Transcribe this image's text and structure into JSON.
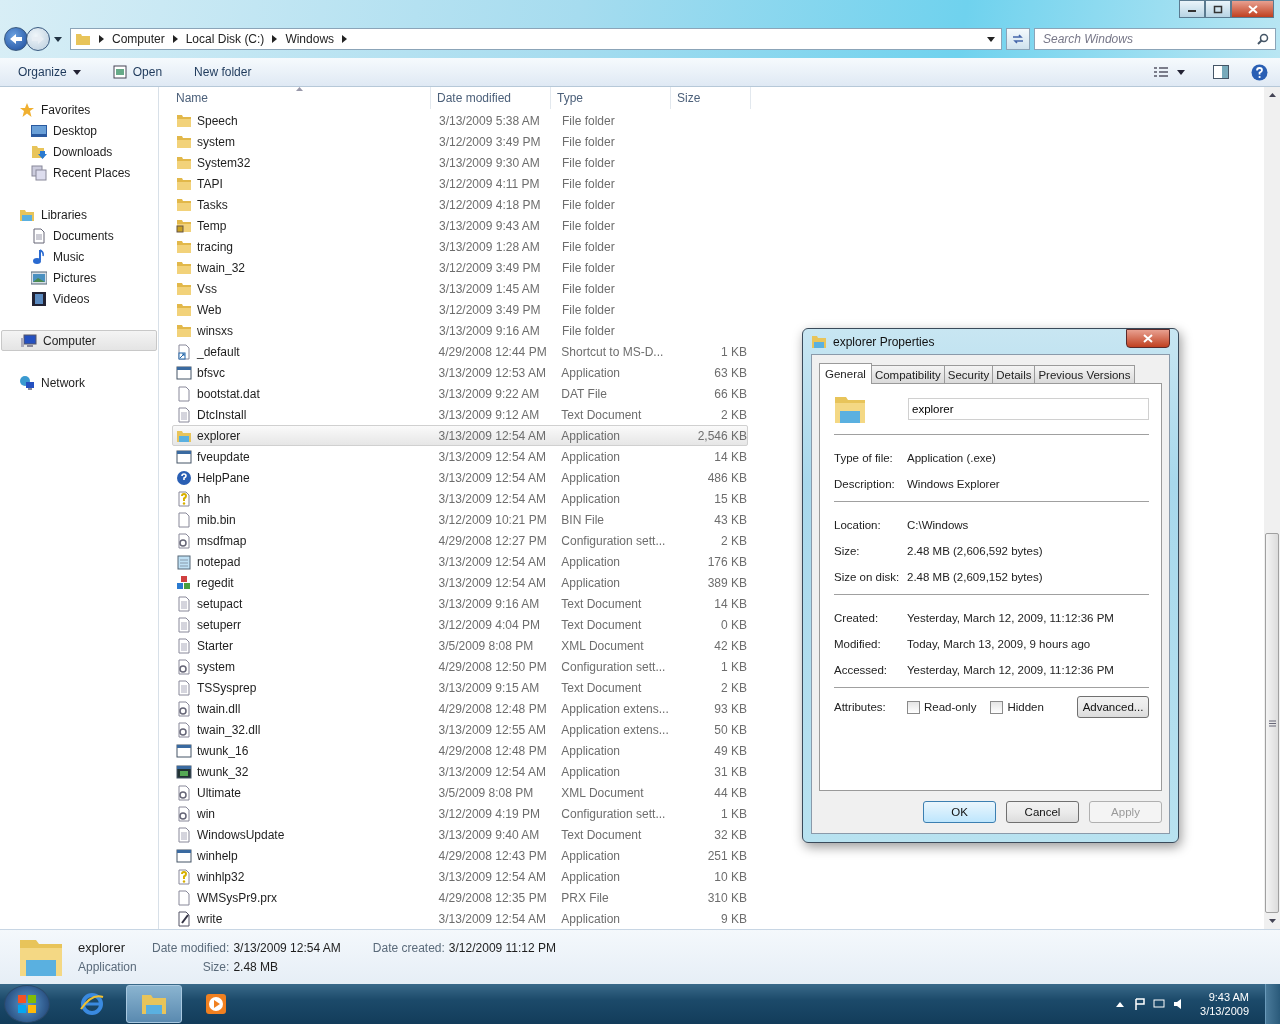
{
  "address": {
    "crumbs": [
      "Computer",
      "Local Disk (C:)",
      "Windows"
    ]
  },
  "search": {
    "placeholder": "Search Windows"
  },
  "toolbar": {
    "buttons": [
      {
        "label": "Organize",
        "kind": "menu"
      },
      {
        "label": "Open",
        "kind": "open"
      },
      {
        "label": "New folder",
        "kind": "plain"
      }
    ]
  },
  "sidebar": {
    "groups": [
      {
        "label": "Favorites",
        "kind": "star",
        "selected": false,
        "children": [
          {
            "label": "Desktop",
            "kind": "desktop"
          },
          {
            "label": "Downloads",
            "kind": "downloads"
          },
          {
            "label": "Recent Places",
            "kind": "recent"
          }
        ]
      },
      {
        "label": "Libraries",
        "kind": "library",
        "selected": false,
        "children": [
          {
            "label": "Documents",
            "kind": "documents"
          },
          {
            "label": "Music",
            "kind": "music"
          },
          {
            "label": "Pictures",
            "kind": "pictures"
          },
          {
            "label": "Videos",
            "kind": "videos"
          }
        ]
      },
      {
        "label": "Computer",
        "kind": "computer",
        "selected": true
      },
      {
        "label": "Network",
        "kind": "network",
        "selected": false
      }
    ]
  },
  "table": {
    "columns": [
      "Name",
      "Date modified",
      "Type",
      "Size"
    ],
    "rows": [
      {
        "name": "Speech",
        "date": "3/13/2009 5:38 AM",
        "type": "File folder",
        "kind": "folder",
        "selected": false
      },
      {
        "name": "system",
        "date": "3/12/2009 3:49 PM",
        "type": "File folder",
        "kind": "folder",
        "selected": false
      },
      {
        "name": "System32",
        "date": "3/13/2009 9:30 AM",
        "type": "File folder",
        "kind": "folder",
        "selected": false
      },
      {
        "name": "TAPI",
        "date": "3/12/2009 4:11 PM",
        "type": "File folder",
        "kind": "folder",
        "selected": false
      },
      {
        "name": "Tasks",
        "date": "3/12/2009 4:18 PM",
        "type": "File folder",
        "kind": "folder",
        "selected": false
      },
      {
        "name": "Temp",
        "date": "3/13/2009 9:43 AM",
        "type": "File folder",
        "kind": "locked-folder",
        "selected": false
      },
      {
        "name": "tracing",
        "date": "3/13/2009 1:28 AM",
        "type": "File folder",
        "kind": "folder",
        "selected": false
      },
      {
        "name": "twain_32",
        "date": "3/12/2009 3:49 PM",
        "type": "File folder",
        "kind": "folder",
        "selected": false
      },
      {
        "name": "Vss",
        "date": "3/13/2009 1:45 AM",
        "type": "File folder",
        "kind": "folder",
        "selected": false
      },
      {
        "name": "Web",
        "date": "3/12/2009 3:49 PM",
        "type": "File folder",
        "kind": "folder",
        "selected": false
      },
      {
        "name": "winsxs",
        "date": "3/13/2009 9:16 AM",
        "type": "File folder",
        "kind": "folder",
        "selected": false
      },
      {
        "name": "_default",
        "date": "4/29/2008 12:44 PM",
        "type": "Shortcut to MS-D...",
        "size": "1 KB",
        "kind": "shortcut",
        "selected": false
      },
      {
        "name": "bfsvc",
        "date": "3/13/2009 12:53 AM",
        "type": "Application",
        "size": "63 KB",
        "kind": "app",
        "selected": false
      },
      {
        "name": "bootstat.dat",
        "date": "3/13/2009 9:22 AM",
        "type": "DAT File",
        "size": "66 KB",
        "kind": "file",
        "selected": false
      },
      {
        "name": "DtcInstall",
        "date": "3/13/2009 9:12 AM",
        "type": "Text Document",
        "size": "2 KB",
        "kind": "text",
        "selected": false
      },
      {
        "name": "explorer",
        "date": "3/13/2009 12:54 AM",
        "type": "Application",
        "size": "2,546 KB",
        "kind": "explorer",
        "selected": true
      },
      {
        "name": "fveupdate",
        "date": "3/13/2009 12:54 AM",
        "type": "Application",
        "size": "14 KB",
        "kind": "app",
        "selected": false
      },
      {
        "name": "HelpPane",
        "date": "3/13/2009 12:54 AM",
        "type": "Application",
        "size": "486 KB",
        "kind": "help",
        "selected": false
      },
      {
        "name": "hh",
        "date": "3/13/2009 12:54 AM",
        "type": "Application",
        "size": "15 KB",
        "kind": "helpfile",
        "selected": false
      },
      {
        "name": "mib.bin",
        "date": "3/12/2009 10:21 PM",
        "type": "BIN File",
        "size": "43 KB",
        "kind": "file",
        "selected": false
      },
      {
        "name": "msdfmap",
        "date": "4/29/2008 12:27 PM",
        "type": "Configuration sett...",
        "size": "2 KB",
        "kind": "config",
        "selected": false
      },
      {
        "name": "notepad",
        "date": "3/13/2009 12:54 AM",
        "type": "Application",
        "size": "176 KB",
        "kind": "notepad",
        "selected": false
      },
      {
        "name": "regedit",
        "date": "3/13/2009 12:54 AM",
        "type": "Application",
        "size": "389 KB",
        "kind": "regedit",
        "selected": false
      },
      {
        "name": "setupact",
        "date": "3/13/2009 9:16 AM",
        "type": "Text Document",
        "size": "14 KB",
        "kind": "text",
        "selected": false
      },
      {
        "name": "setuperr",
        "date": "3/12/2009 4:04 PM",
        "type": "Text Document",
        "size": "0 KB",
        "kind": "text",
        "selected": false
      },
      {
        "name": "Starter",
        "date": "3/5/2009 8:08 PM",
        "type": "XML Document",
        "size": "42 KB",
        "kind": "text",
        "selected": false
      },
      {
        "name": "system",
        "date": "4/29/2008 12:50 PM",
        "type": "Configuration sett...",
        "size": "1 KB",
        "kind": "config",
        "selected": false
      },
      {
        "name": "TSSysprep",
        "date": "3/13/2009 9:15 AM",
        "type": "Text Document",
        "size": "2 KB",
        "kind": "text",
        "selected": false
      },
      {
        "name": "twain.dll",
        "date": "4/29/2008 12:48 PM",
        "type": "Application extens...",
        "size": "93 KB",
        "kind": "config",
        "selected": false
      },
      {
        "name": "twain_32.dll",
        "date": "3/13/2009 12:55 AM",
        "type": "Application extens...",
        "size": "50 KB",
        "kind": "config",
        "selected": false
      },
      {
        "name": "twunk_16",
        "date": "4/29/2008 12:48 PM",
        "type": "Application",
        "size": "49 KB",
        "kind": "app",
        "selected": false
      },
      {
        "name": "twunk_32",
        "date": "3/13/2009 12:54 AM",
        "type": "Application",
        "size": "31 KB",
        "kind": "dark-app",
        "selected": false
      },
      {
        "name": "Ultimate",
        "date": "3/5/2009 8:08 PM",
        "type": "XML Document",
        "size": "44 KB",
        "kind": "config",
        "selected": false
      },
      {
        "name": "win",
        "date": "3/12/2009 4:19 PM",
        "type": "Configuration sett...",
        "size": "1 KB",
        "kind": "config",
        "selected": false
      },
      {
        "name": "WindowsUpdate",
        "date": "3/13/2009 9:40 AM",
        "type": "Text Document",
        "size": "32 KB",
        "kind": "text",
        "selected": false
      },
      {
        "name": "winhelp",
        "date": "4/29/2008 12:43 PM",
        "type": "Application",
        "size": "251 KB",
        "kind": "app",
        "selected": false
      },
      {
        "name": "winhlp32",
        "date": "3/13/2009 12:54 AM",
        "type": "Application",
        "size": "10 KB",
        "kind": "helpfile",
        "selected": false
      },
      {
        "name": "WMSysPr9.prx",
        "date": "4/29/2008 12:35 PM",
        "type": "PRX File",
        "size": "310 KB",
        "kind": "file",
        "selected": false
      },
      {
        "name": "write",
        "date": "3/13/2009 12:54 AM",
        "type": "Application",
        "size": "9 KB",
        "kind": "write",
        "selected": false
      }
    ]
  },
  "details_pane": {
    "name": "explorer",
    "type": "Application",
    "fields": [
      {
        "label": "Date modified:",
        "value": "3/13/2009 12:54 AM"
      },
      {
        "label": "Date created:",
        "value": "3/12/2009 11:12 PM"
      },
      {
        "label": "Size:",
        "value": "2.48 MB"
      }
    ]
  },
  "dialog": {
    "title": "explorer Properties",
    "tabs": [
      {
        "label": "General",
        "selected": true
      },
      {
        "label": "Compatibility",
        "selected": false
      },
      {
        "label": "Security",
        "selected": false
      },
      {
        "label": "Details",
        "selected": false
      },
      {
        "label": "Previous Versions",
        "selected": false
      }
    ],
    "name_field": {
      "value": "explorer"
    },
    "sections": [
      [
        {
          "label": "Type of file:",
          "value": "Application (.exe)"
        },
        {
          "label": "Description:",
          "value": "Windows Explorer"
        }
      ],
      [
        {
          "label": "Location:",
          "value": "C:\\Windows"
        },
        {
          "label": "Size:",
          "value": "2.48 MB (2,606,592 bytes)"
        },
        {
          "label": "Size on disk:",
          "value": "2.48 MB (2,609,152 bytes)"
        }
      ],
      [
        {
          "label": "Created:",
          "value": "Yesterday, March 12, 2009, 11:12:36 PM"
        },
        {
          "label": "Modified:",
          "value": "Today, March 13, 2009, 9 hours ago"
        },
        {
          "label": "Accessed:",
          "value": "Yesterday, March 12, 2009, 11:12:36 PM"
        }
      ]
    ],
    "attributes_label": "Attributes:",
    "attributes": [
      {
        "label": "Read-only",
        "checked": false
      },
      {
        "label": "Hidden",
        "checked": false
      }
    ],
    "advanced_button": "Advanced...",
    "buttons": [
      {
        "label": "OK",
        "default": true,
        "disabled": false
      },
      {
        "label": "Cancel",
        "default": false,
        "disabled": false
      },
      {
        "label": "Apply",
        "default": false,
        "disabled": true
      }
    ]
  },
  "taskbar": {
    "apps": [
      {
        "kind": "browser",
        "active": false
      },
      {
        "kind": "explorer",
        "active": true
      },
      {
        "kind": "media",
        "active": false
      }
    ],
    "time": "9:43 AM",
    "date": "3/13/2009"
  }
}
